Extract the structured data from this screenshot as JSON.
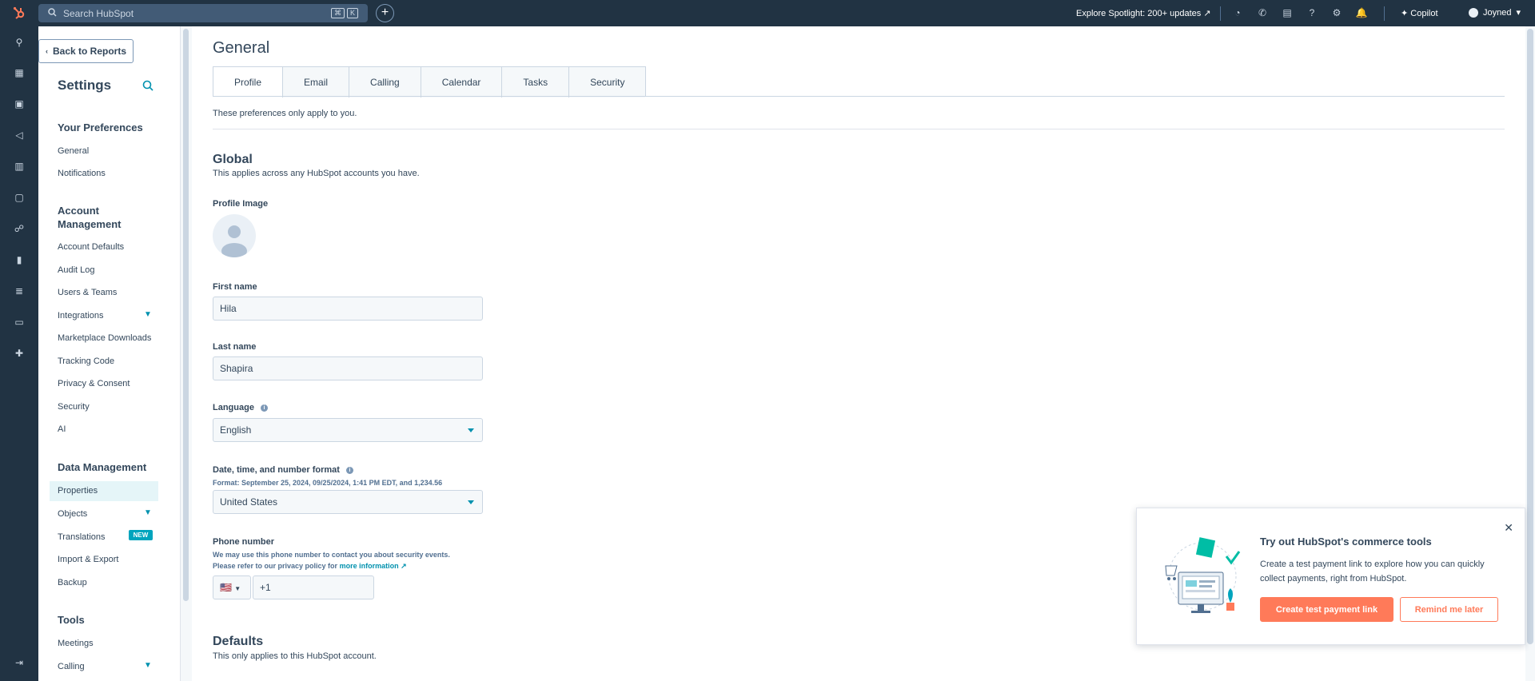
{
  "topbar": {
    "search_placeholder": "Search HubSpot",
    "shortcut_keys": [
      "⌘",
      "K"
    ],
    "spotlight": "Explore Spotlight: 200+ updates",
    "copilot": "Copilot",
    "account": "Joyned"
  },
  "sidebar": {
    "back_label": "Back to Reports",
    "title": "Settings",
    "sections": {
      "preferences": "Your Preferences",
      "account_management": "Account Management",
      "data_management": "Data Management",
      "tools": "Tools"
    },
    "items": {
      "general": "General",
      "notifications": "Notifications",
      "account_defaults": "Account Defaults",
      "audit_log": "Audit Log",
      "users_teams": "Users & Teams",
      "integrations": "Integrations",
      "marketplace_downloads": "Marketplace Downloads",
      "tracking_code": "Tracking Code",
      "privacy_consent": "Privacy & Consent",
      "security": "Security",
      "ai": "AI",
      "properties": "Properties",
      "objects": "Objects",
      "translations": "Translations",
      "import_export": "Import & Export",
      "backup": "Backup",
      "meetings": "Meetings",
      "calling": "Calling"
    },
    "new_badge": "NEW"
  },
  "main": {
    "title": "General",
    "tabs": [
      "Profile",
      "Email",
      "Calling",
      "Calendar",
      "Tasks",
      "Security"
    ],
    "intro": "These preferences only apply to you.",
    "global_heading": "Global",
    "global_sub": "This applies across any HubSpot accounts you have.",
    "profile_image_label": "Profile Image",
    "first_name_label": "First name",
    "first_name_value": "Hila",
    "last_name_label": "Last name",
    "last_name_value": "Shapira",
    "language_label": "Language",
    "language_value": "English",
    "format_label": "Date, time, and number format",
    "format_hint": "Format: September 25, 2024, 09/25/2024, 1:41 PM EDT, and 1,234.56",
    "format_value": "United States",
    "phone_label": "Phone number",
    "phone_hint_1": "We may use this phone number to contact you about security events.",
    "phone_hint_2": "Please refer to our privacy policy for",
    "phone_hint_link": "more information",
    "phone_flag": "🇺🇸",
    "phone_value": "+1",
    "defaults_heading": "Defaults",
    "defaults_sub": "This only applies to this HubSpot account."
  },
  "popup": {
    "title": "Try out HubSpot's commerce tools",
    "text": "Create a test payment link to explore how you can quickly collect payments, right from HubSpot.",
    "primary": "Create test payment link",
    "secondary": "Remind me later"
  },
  "colors": {
    "nav_dark": "#213343",
    "accent": "#ff7a59",
    "link": "#0091ae"
  }
}
